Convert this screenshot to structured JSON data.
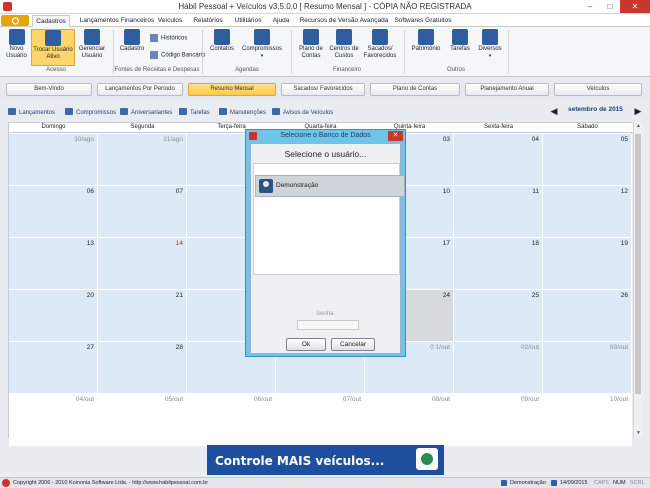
{
  "window": {
    "title": "Hábil Pessoal + Veículos v3.5.0.0 [ Resumo Mensal ] - CÓPIA NÃO REGISTRADA",
    "minimize": "–",
    "maximize": "□",
    "close": "✕"
  },
  "ribbon_tabs": [
    "Cadastros",
    "Lançamentos Financeiros",
    "Veículos",
    "Relatórios",
    "Utilitários",
    "Ajuda",
    "Recursos de Versão Avançada",
    "Softwares Gratuitos"
  ],
  "ribbon": {
    "acesso": {
      "novo": "Novo Usuário",
      "trocar": "Trocar Usuário Ativo",
      "gerenciar": "Gerenciar Usuário",
      "label": "Acesso"
    },
    "fontes": {
      "cadastro": "Cadastro",
      "historicos": "Históricos",
      "codigo_bancario": "Código Bancário",
      "label": "Fontes de Receitas e Despesas"
    },
    "agendas": {
      "contatos": "Contatos",
      "compromissos": "Compromissos",
      "label": "Agendas"
    },
    "financeiro": {
      "plano": "Plano de Contas",
      "centros": "Centros de Custos",
      "sacados": "Sacados/ Favorecidos",
      "label": "Financeiro"
    },
    "outros": {
      "patrimonio": "Patrimônio",
      "tarefas": "Tarefas",
      "diversos": "Diversos",
      "label": "Outros"
    }
  },
  "nav_buttons": [
    "Bem-Vindo",
    "Lançamentos Por Período",
    "Resumo Mensal",
    "Sacados/ Favorecidos",
    "Plano de Contas",
    "Planejamento Anual",
    "Veículos"
  ],
  "subbar": {
    "items": [
      "Lançamentos",
      "Compromissos",
      "Aniversariantes",
      "Tarefas",
      "Manutenções",
      "Avisos de Veículos"
    ],
    "month": "setembro de 2015",
    "prev": "◀",
    "next": "▶"
  },
  "calendar": {
    "days": [
      "Domingo",
      "Segunda",
      "Terça-feira",
      "Quarta-feira",
      "Quinta-feira",
      "Sexta-feira",
      "Sábado"
    ],
    "weeks": [
      [
        "30/ago",
        "31/ago",
        "",
        "",
        "03",
        "04",
        "05"
      ],
      [
        "06",
        "07",
        "",
        "",
        "10",
        "11",
        "12"
      ],
      [
        "13",
        "14",
        "",
        "",
        "17",
        "18",
        "19"
      ],
      [
        "20",
        "21",
        "",
        "",
        "24",
        "25",
        "26"
      ],
      [
        "27",
        "28",
        "",
        "",
        "0 1/out",
        "02/out",
        "03/out"
      ],
      [
        "04/out",
        "05/out",
        "06/out",
        "07/out",
        "08/out",
        "09/out",
        "10/out"
      ]
    ],
    "highlight_color": "#d81b1b"
  },
  "banner": {
    "text": "Controle MAIS veículos..."
  },
  "dialog": {
    "title": "Selecione o Banco de Dados",
    "heading": "Selecione o usuário...",
    "user": "Demonstração",
    "password_label": "Senha:",
    "ok": "Ok",
    "cancel": "Cancelar",
    "close": "✕"
  },
  "status": {
    "copyright": "Copyright 2006 - 2010 Koinonia Software Ltda. - http://www.habilpessoal.com.br",
    "user": "Demonstração",
    "date": "14/09/2015",
    "caps": "CAPS",
    "num": "NUM",
    "scrl": "SCRL"
  }
}
